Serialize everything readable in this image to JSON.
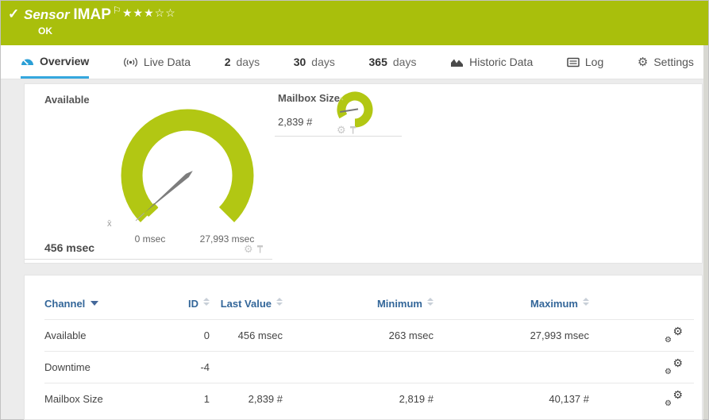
{
  "header": {
    "check_icon": "✓",
    "title_prefix": "Sensor",
    "title": "IMAP",
    "flag_icon": "⚐",
    "stars_filled": "★★★",
    "stars_empty": "☆☆",
    "status": "OK"
  },
  "tabs": {
    "overview": "Overview",
    "live_data": "Live Data",
    "days2_num": "2",
    "days2_label": "days",
    "days30_num": "30",
    "days30_label": "days",
    "days365_num": "365",
    "days365_label": "days",
    "historic": "Historic Data",
    "log": "Log",
    "settings": "Settings",
    "settings_gear_icon": "⚙"
  },
  "gauges": {
    "available": {
      "title": "Available",
      "value": "456 msec",
      "min_label": "0 msec",
      "max_label": "27,993 msec",
      "avg_marker": "x̄",
      "gear_icon": "⚙"
    },
    "mailbox": {
      "title": "Mailbox Size",
      "value": "2,839 #",
      "gear_icon": "⚙"
    }
  },
  "table": {
    "headers": {
      "channel": "Channel",
      "id": "ID",
      "last_value": "Last Value",
      "minimum": "Minimum",
      "maximum": "Maximum"
    },
    "rows": [
      {
        "channel": "Available",
        "id": "0",
        "last_value": "456 msec",
        "minimum": "263 msec",
        "maximum": "27,993 msec"
      },
      {
        "channel": "Downtime",
        "id": "-4",
        "last_value": "",
        "minimum": "",
        "maximum": ""
      },
      {
        "channel": "Mailbox Size",
        "id": "1",
        "last_value": "2,839 #",
        "minimum": "2,819 #",
        "maximum": "40,137 #"
      }
    ],
    "row_settings_icon": "⚙"
  },
  "colors": {
    "status_ok_green": "#a9bf0c",
    "gauge_green": "#b2c713",
    "active_tab_blue": "#35a7de",
    "table_header_blue": "#336699"
  }
}
